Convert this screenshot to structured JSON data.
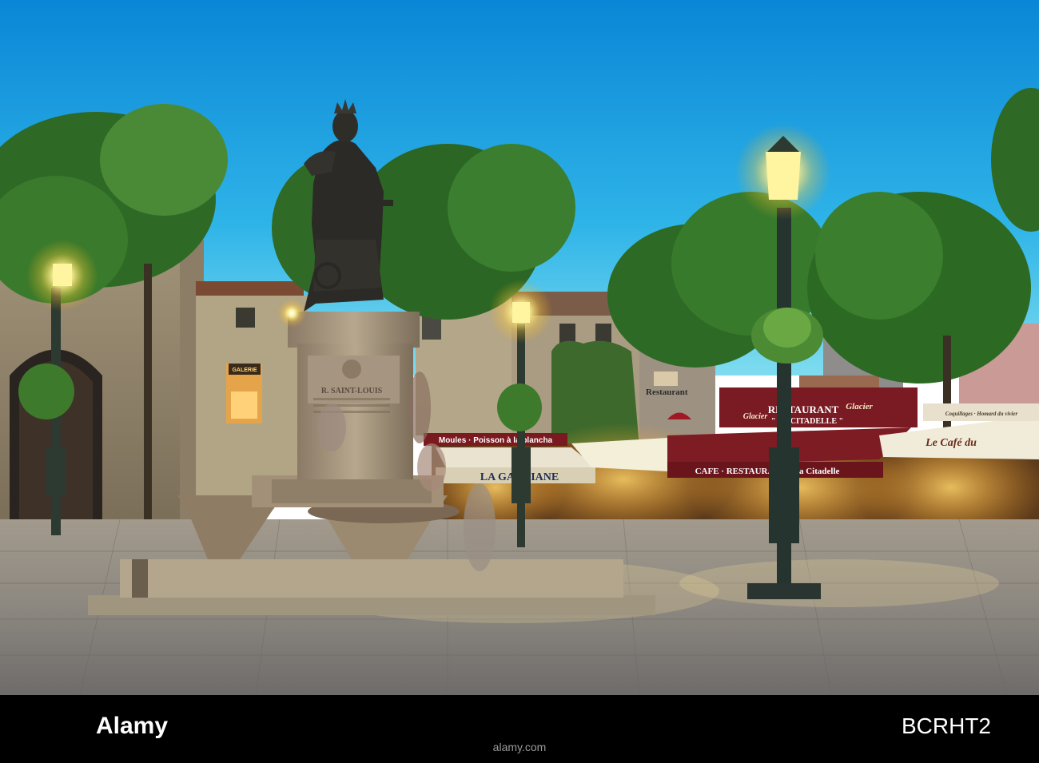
{
  "monument": {
    "inscription_title": "R. SAINT-LOUIS"
  },
  "signs": {
    "moules_banner": "Moules · Poisson à la plancha",
    "gardiane_awning": "LA GARDIANE",
    "citadelle_top_left": "Glacier",
    "citadelle_top_center": "RESTAURANT",
    "citadelle_top_sub": "\" LA CITADELLE \"",
    "citadelle_top_right": "Glacier",
    "citadelle_awning": "CAFE · RESTAURANT · La Citadelle",
    "cafe_awning": "Le Café du",
    "cafe_top_small": "Coquillages · Homard du vivier",
    "restaurant_facade": "Restaurant",
    "galerie_sign": "GALERIE"
  },
  "watermark": {
    "left_code": "Alamy",
    "right_code": "BCRHT2",
    "domain": "alamy.com"
  },
  "colors": {
    "sky_top": "#0a86d6",
    "sky_bottom": "#6fd6f0",
    "lamp_glow": "#fff6a0",
    "awning_red": "#8a1a24",
    "tree_green": "#2f6e28",
    "pavement": "#8e8a84",
    "watermark_bar": "#000000"
  }
}
